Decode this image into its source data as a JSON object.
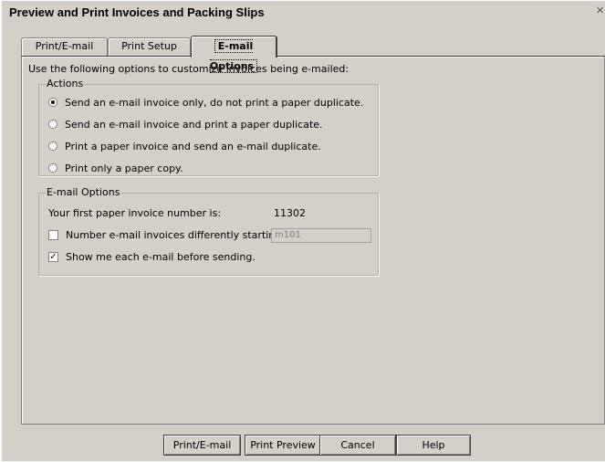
{
  "window": {
    "title": "Preview and Print Invoices and Packing Slips"
  },
  "tabs": [
    {
      "label": "Print/E-mail"
    },
    {
      "label": "Print Setup"
    },
    {
      "label": "E-mail Options"
    }
  ],
  "intro_text": "Use the following options to customize invoices being e-mailed:",
  "actions": {
    "legend": "Actions",
    "selected_index": 0,
    "options": [
      {
        "label": "Send an e-mail invoice only, do not print a paper duplicate."
      },
      {
        "label": "Send an e-mail invoice and print a paper duplicate."
      },
      {
        "label": "Print a paper invoice and send an e-mail duplicate."
      },
      {
        "label": "Print only a paper copy."
      }
    ]
  },
  "email_options": {
    "legend": "E-mail Options",
    "first_invoice_label": "Your first paper invoice number is:",
    "first_invoice_number": "11302",
    "number_differently_label": "Number e-mail invoices differently starting with:",
    "number_differently_checked": false,
    "start_number_value": "m101",
    "show_each_label": "Show me each e-mail before sending.",
    "show_each_checked": true
  },
  "buttons": {
    "print_email": "Print/E-mail",
    "print_preview": "Print Preview",
    "cancel": "Cancel",
    "help": "Help"
  },
  "icons": {
    "close": "close-icon"
  }
}
